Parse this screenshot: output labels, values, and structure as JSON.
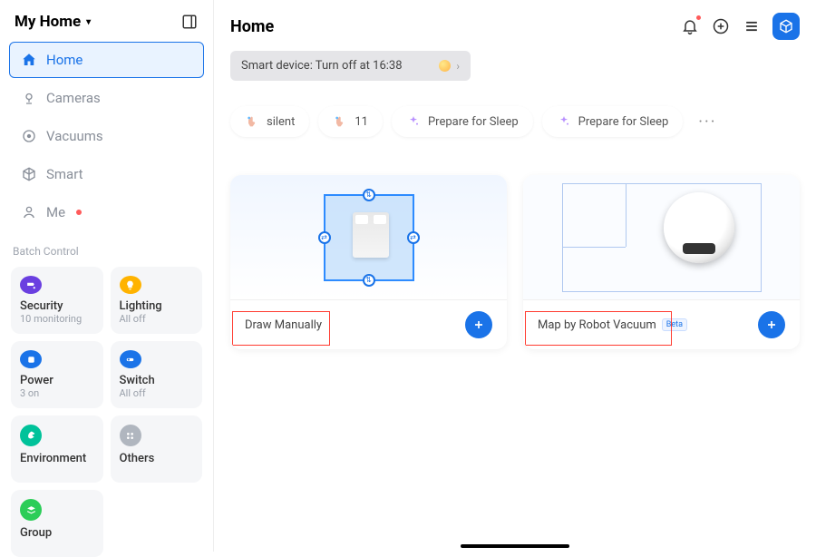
{
  "sidebar": {
    "title": "My Home",
    "nav": [
      {
        "label": "Home",
        "icon": "home-icon",
        "active": true
      },
      {
        "label": "Cameras",
        "icon": "camera-icon",
        "active": false
      },
      {
        "label": "Vacuums",
        "icon": "vacuum-icon",
        "active": false
      },
      {
        "label": "Smart",
        "icon": "cube-icon",
        "active": false
      },
      {
        "label": "Me",
        "icon": "user-icon",
        "active": false,
        "dot": true
      }
    ],
    "batch_label": "Batch Control",
    "cards": [
      {
        "title": "Security",
        "sub": "10 monitoring",
        "color": "#6a3fe0",
        "icon": "camera-fill-icon"
      },
      {
        "title": "Lighting",
        "sub": "All off",
        "color": "#ffb300",
        "icon": "bulb-icon"
      },
      {
        "title": "Power",
        "sub": "3 on",
        "color": "#1a73e8",
        "icon": "plug-icon"
      },
      {
        "title": "Switch",
        "sub": "All off",
        "color": "#1a73e8",
        "icon": "switch-icon"
      },
      {
        "title": "Environment",
        "sub": "",
        "color": "#00c29a",
        "icon": "leaf-icon"
      },
      {
        "title": "Others",
        "sub": "",
        "color": "#b0b6bf",
        "icon": "grid-icon"
      },
      {
        "title": "Group",
        "sub": "",
        "color": "#2bcd58",
        "icon": "layers-icon"
      }
    ]
  },
  "main": {
    "title": "Home",
    "banner": "Smart device: Turn off at 16:38",
    "scenes": [
      {
        "label": "silent",
        "icon": "touch-icon"
      },
      {
        "label": "11",
        "icon": "touch-icon"
      },
      {
        "label": "Prepare for Sleep",
        "icon": "sparkle-icon"
      },
      {
        "label": "Prepare for Sleep",
        "icon": "sparkle-icon"
      }
    ],
    "big_cards": [
      {
        "label": "Draw Manually",
        "type": "draw"
      },
      {
        "label": "Map by Robot Vacuum",
        "type": "map",
        "badge": "Beta"
      }
    ]
  },
  "colors": {
    "accent": "#1a73e8",
    "highlight": "#ff3b30"
  }
}
